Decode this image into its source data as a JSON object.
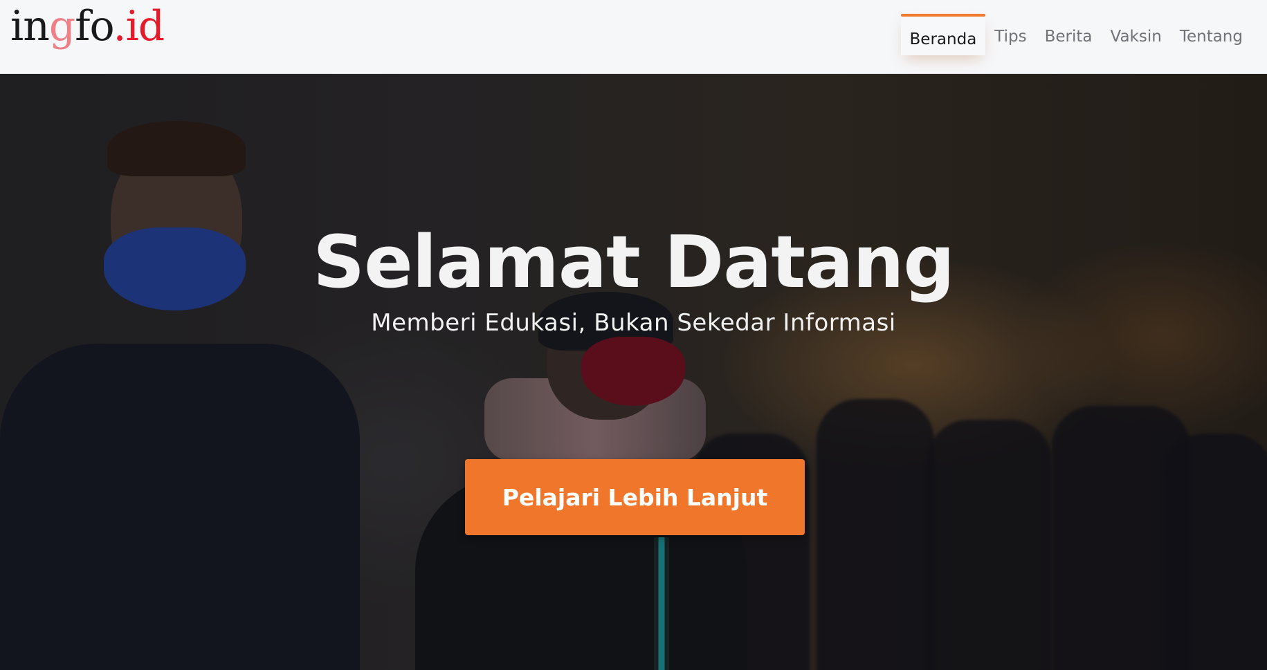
{
  "logo": {
    "part_1": "in",
    "part_2": "g",
    "part_3": "fo",
    "part_4": ".id"
  },
  "nav": {
    "items": [
      {
        "label": "Beranda",
        "active": true
      },
      {
        "label": "Tips",
        "active": false
      },
      {
        "label": "Berita",
        "active": false
      },
      {
        "label": "Vaksin",
        "active": false
      },
      {
        "label": "Tentang",
        "active": false
      }
    ]
  },
  "hero": {
    "title": "Selamat Datang",
    "subtitle": "Memberi Edukasi, Bukan Sekedar Informasi",
    "cta_label": "Pelajari Lebih Lanjut",
    "background_image": "people-wearing-face-masks-photo"
  },
  "colors": {
    "accent": "#f0762c",
    "logo_red": "#e31b2a",
    "logo_pink": "#f08088",
    "navbar_bg": "#f6f7f9"
  }
}
